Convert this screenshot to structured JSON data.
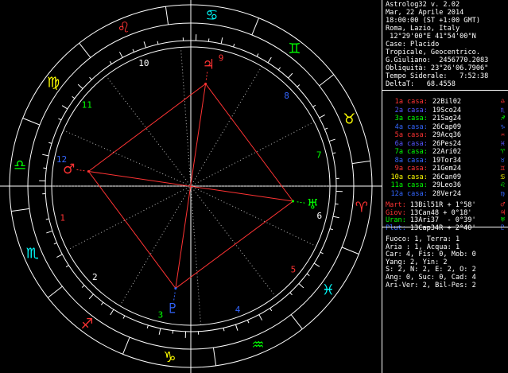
{
  "header": {
    "title": "Astrolog32 v. 2.02",
    "date": "Mar, 22 Aprile 2014",
    "time": "18:00:00 (ST +1:00 GMT)",
    "place": "Roma, Lazio, Italy",
    "coords": " 12°29'00\"E 41°54'00\"N",
    "houses": "Case: Placido",
    "zodiac": "Tropicale, Geocentrico.",
    "julian": "G.Giuliano:  2456770.2083",
    "obliquity": "Obliquità: 23°26'06.7906\"",
    "sidereal": "Tempo Siderale:   7:52:38",
    "delta": "DeltaT:   68.4558"
  },
  "cusps": [
    {
      "num": "1a",
      "label": "casa:",
      "value": "22Bil02",
      "glyph": "♎",
      "color": "#ff3333"
    },
    {
      "num": "2a",
      "label": "casa:",
      "value": "19Sco24",
      "glyph": "♏",
      "color": "#5555ff"
    },
    {
      "num": "3a",
      "label": "casa:",
      "value": "21Sag24",
      "glyph": "♐",
      "color": "#00ff00"
    },
    {
      "num": "4a",
      "label": "casa:",
      "value": "26Cap09",
      "glyph": "♑",
      "color": "#3366ff"
    },
    {
      "num": "5a",
      "label": "casa:",
      "value": "29Acq36",
      "glyph": "♒",
      "color": "#ff3333"
    },
    {
      "num": "6a",
      "label": "casa:",
      "value": "26Pes24",
      "glyph": "♓",
      "color": "#5555ff"
    },
    {
      "num": "7a",
      "label": "casa:",
      "value": "22Ari02",
      "glyph": "♈",
      "color": "#00ff00"
    },
    {
      "num": "8a",
      "label": "casa:",
      "value": "19Tor34",
      "glyph": "♉",
      "color": "#3366ff"
    },
    {
      "num": "9a",
      "label": "casa:",
      "value": "21Gem24",
      "glyph": "♊",
      "color": "#ff3333"
    },
    {
      "num": "10a",
      "label": "casa:",
      "value": "26Can09",
      "glyph": "♋",
      "color": "#ffff00"
    },
    {
      "num": "11a",
      "label": "casa:",
      "value": "29Leo36",
      "glyph": "♌",
      "color": "#00ff00"
    },
    {
      "num": "12a",
      "label": "casa:",
      "value": "28Ver24",
      "glyph": "♍",
      "color": "#3366ff"
    }
  ],
  "planets": [
    {
      "name": "Mart:",
      "value": "13Bil51R + 1°58'",
      "glyph": "♂",
      "color": "#ff3333"
    },
    {
      "name": "Giov:",
      "value": "13Can48 + 0°18'",
      "glyph": "♃",
      "color": "#ff3333"
    },
    {
      "name": "Uran:",
      "value": "13Ari37  - 0°39'",
      "glyph": "♅",
      "color": "#00ff00"
    },
    {
      "name": "Plut:",
      "value": "13Cap34R + 2°40'",
      "glyph": "♇",
      "color": "#3366ff"
    }
  ],
  "stats": [
    "Fuoco: 1, Terra: 1",
    "Aria : 1, Acqua: 1",
    "Car: 4, Fis: 0, Mob: 0",
    "Yang: 2, Yin: 2",
    "S: 2, N: 2, E: 2, O: 2",
    "Ang: 0, Suc: 0, Cad: 4",
    "Ari-Ver: 2, Bil-Pes: 2"
  ],
  "wheel": {
    "ascendant_lon": 202.03,
    "house_cusps_lon": [
      202.03,
      229.4,
      261.4,
      296.15,
      329.6,
      356.4,
      22.03,
      49.57,
      81.4,
      116.15,
      149.6,
      178.4
    ],
    "signs": [
      {
        "glyph": "♈",
        "name": "aries-sign",
        "color": "#ff3333"
      },
      {
        "glyph": "♉",
        "name": "taurus-sign",
        "color": "#ffff00"
      },
      {
        "glyph": "♊",
        "name": "gemini-sign",
        "color": "#00ff00"
      },
      {
        "glyph": "♋",
        "name": "cancer-sign",
        "color": "#00ffff"
      },
      {
        "glyph": "♌",
        "name": "leo-sign",
        "color": "#ff3333"
      },
      {
        "glyph": "♍",
        "name": "virgo-sign",
        "color": "#ffff00"
      },
      {
        "glyph": "♎",
        "name": "libra-sign",
        "color": "#00ff00"
      },
      {
        "glyph": "♏",
        "name": "scorpio-sign",
        "color": "#00ffff"
      },
      {
        "glyph": "♐",
        "name": "sagittarius-sign",
        "color": "#ff3333"
      },
      {
        "glyph": "♑",
        "name": "capricorn-sign",
        "color": "#ffff00"
      },
      {
        "glyph": "♒",
        "name": "aquarius-sign",
        "color": "#00ff00"
      },
      {
        "glyph": "♓",
        "name": "pisces-sign",
        "color": "#00ffff"
      }
    ],
    "house_numbers": [
      "1",
      "2",
      "3",
      "4",
      "5",
      "6",
      "7",
      "8",
      "9",
      "10",
      "11",
      "12"
    ],
    "house_number_colors": [
      "#ff3333",
      "#ffffff",
      "#00ff00",
      "#3366ff",
      "#ff3333",
      "#ffffff",
      "#00ff00",
      "#3366ff",
      "#ff3333",
      "#ffffff",
      "#00ff00",
      "#3366ff"
    ],
    "planet_marks": [
      {
        "glyph": "♂",
        "name": "mars-planet",
        "lon": 193.85,
        "color": "#ff3333"
      },
      {
        "glyph": "♃",
        "name": "jupiter-planet",
        "lon": 103.8,
        "color": "#ff3333"
      },
      {
        "glyph": "♅",
        "name": "uranus-planet",
        "lon": 13.62,
        "color": "#00ff00"
      },
      {
        "glyph": "♇",
        "name": "pluto-planet",
        "lon": 283.57,
        "color": "#3366ff"
      }
    ],
    "aspect_color": "#ff3333"
  }
}
